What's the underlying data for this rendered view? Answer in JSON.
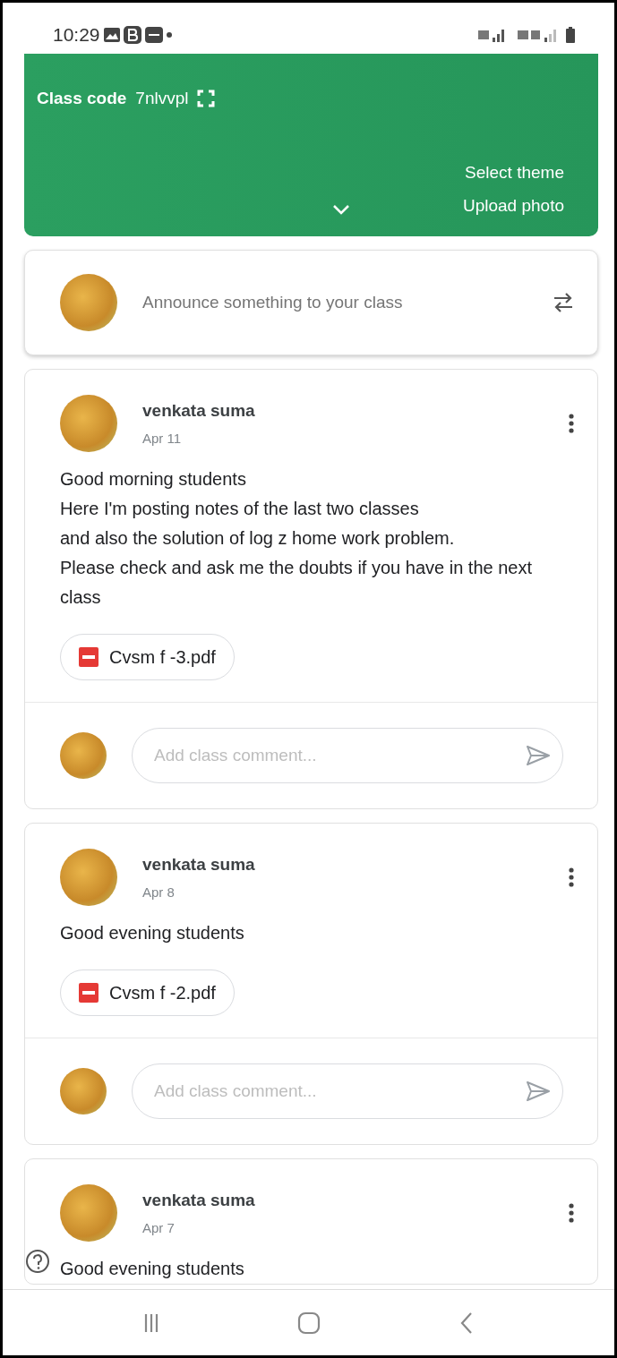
{
  "status_bar": {
    "time": "10:29"
  },
  "banner": {
    "class_code_label": "Class code",
    "class_code": "7nlvvpl",
    "links": [
      "Select theme",
      "Upload photo"
    ]
  },
  "announce": {
    "placeholder": "Announce something to your class"
  },
  "posts": [
    {
      "author": "venkata suma",
      "date": "Apr 11",
      "body": "Good morning students\nHere I'm posting notes of the last two classes\nand also the solution of log z home work problem.\nPlease check and ask me the doubts if you have in the next class",
      "attachment": "Cvsm f -3.pdf",
      "comment_placeholder": "Add class comment..."
    },
    {
      "author": "venkata suma",
      "date": "Apr 8",
      "body": "Good evening students",
      "attachment": "Cvsm f -2.pdf",
      "comment_placeholder": "Add class comment..."
    },
    {
      "author": "venkata suma",
      "date": "Apr 7",
      "body": "Good evening students"
    }
  ]
}
